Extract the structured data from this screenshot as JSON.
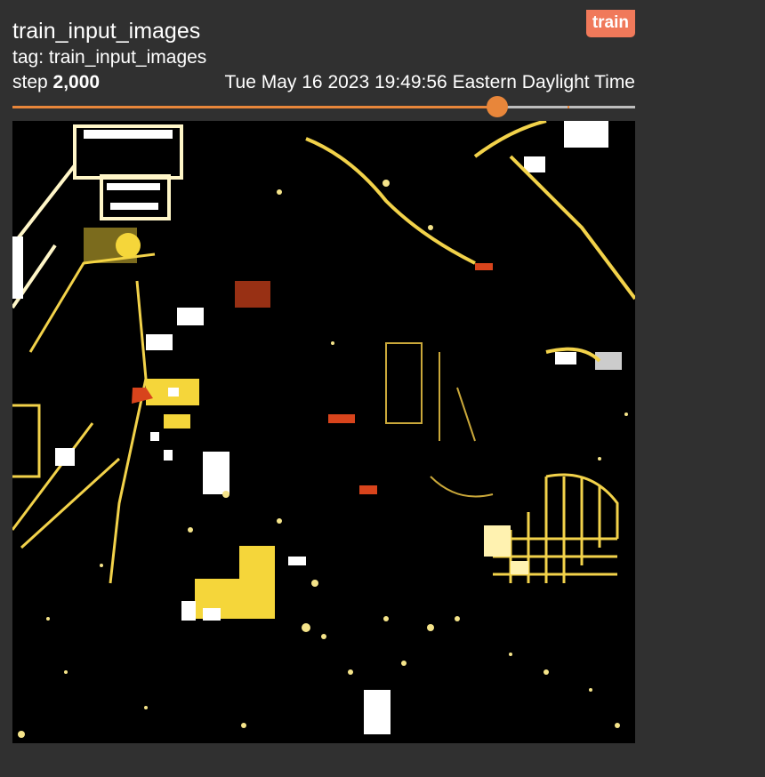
{
  "card": {
    "title": "train_input_images",
    "tag_label": "tag: train_input_images",
    "run_badge": "train",
    "step_prefix": "step",
    "step_value": "2,000",
    "timestamp": "Tue May 16 2023 19:49:56 Eastern Daylight Time"
  },
  "slider": {
    "value_fraction": 0.779,
    "tick_fraction": 0.891
  },
  "image": {
    "description_icon": "satellite-image"
  },
  "colors": {
    "background": "#303030",
    "accent": "#e8863a",
    "badge": "#f0795a"
  }
}
